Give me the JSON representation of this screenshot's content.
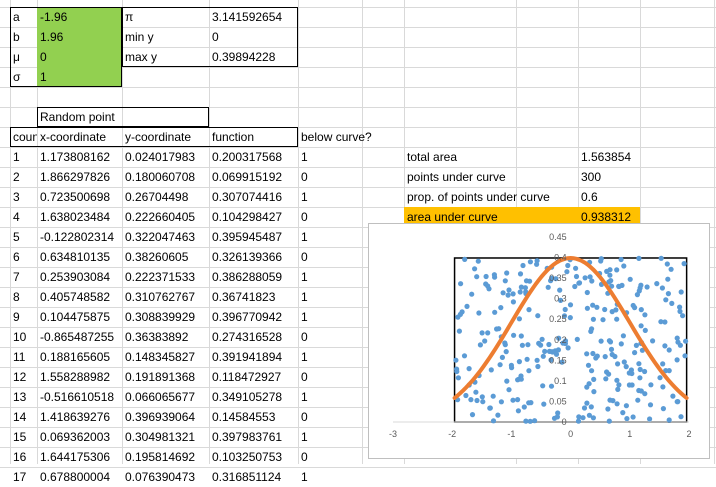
{
  "params": [
    {
      "label": "a",
      "value": "-1.96"
    },
    {
      "label": "b",
      "value": "1.96"
    },
    {
      "label": "μ",
      "value": "0"
    },
    {
      "label": "σ",
      "value": "1"
    }
  ],
  "constants": [
    {
      "label": "π",
      "value": "3.141592654"
    },
    {
      "label": "min y",
      "value": "0"
    },
    {
      "label": "max y",
      "value": "0.39894228"
    }
  ],
  "table": {
    "group_header": "Random point",
    "headers": [
      "count",
      "x-coordinate",
      "y-coordinate",
      "function",
      "below curve?"
    ],
    "rows": [
      [
        "1",
        "1.173808162",
        "0.024017983",
        "0.200317568",
        "1"
      ],
      [
        "2",
        "1.866297826",
        "0.180060708",
        "0.069915192",
        "0"
      ],
      [
        "3",
        "0.723500698",
        "0.26704498",
        "0.307074416",
        "1"
      ],
      [
        "4",
        "1.638023484",
        "0.222660405",
        "0.104298427",
        "0"
      ],
      [
        "5",
        "-0.122802314",
        "0.322047463",
        "0.395945487",
        "1"
      ],
      [
        "6",
        "0.634810135",
        "0.38260605",
        "0.326139366",
        "0"
      ],
      [
        "7",
        "0.253903084",
        "0.222371533",
        "0.386288059",
        "1"
      ],
      [
        "8",
        "0.405748582",
        "0.310762767",
        "0.36741823",
        "1"
      ],
      [
        "9",
        "0.104475875",
        "0.308839929",
        "0.396770942",
        "1"
      ],
      [
        "10",
        "-0.865487255",
        "0.36383892",
        "0.274316528",
        "0"
      ],
      [
        "11",
        "0.188165605",
        "0.148345827",
        "0.391941894",
        "1"
      ],
      [
        "12",
        "1.558288982",
        "0.191891368",
        "0.118472927",
        "0"
      ],
      [
        "13",
        "-0.516610518",
        "0.066065677",
        "0.349105278",
        "1"
      ],
      [
        "14",
        "1.418639276",
        "0.396939064",
        "0.14584553",
        "0"
      ],
      [
        "15",
        "0.069362003",
        "0.304981321",
        "0.397983761",
        "1"
      ],
      [
        "16",
        "1.644175306",
        "0.195814692",
        "0.103250753",
        "0"
      ],
      [
        "17",
        "0.678800004",
        "0.076390473",
        "0.316851124",
        "1"
      ]
    ]
  },
  "summary": [
    {
      "label": "total area",
      "value": "1.563854"
    },
    {
      "label": "points under curve",
      "value": "300"
    },
    {
      "label": "prop. of points under curve",
      "value": "0.6"
    },
    {
      "label": "area under curve",
      "value": "0.938312"
    }
  ],
  "colors": {
    "green": "#92d050",
    "orange": "#ffc000",
    "points": "#5b9bd5",
    "curve": "#ed7d31"
  },
  "chart_data": {
    "type": "scatter",
    "xlim": [
      -3,
      2
    ],
    "ylim": [
      0,
      0.45
    ],
    "x_ticks": [
      "-3",
      "-2",
      "-1",
      "0",
      "1",
      "2"
    ],
    "y_ticks": [
      "0",
      "0.05",
      "0.1",
      "0.15",
      "0.2",
      "0.25",
      "0.3",
      "0.35",
      "0.4",
      "0.45"
    ],
    "series": [
      {
        "kind": "scatter",
        "sample_count": 300,
        "x_range": [
          -1.96,
          1.96
        ],
        "y_range": [
          0,
          0.39894228
        ]
      },
      {
        "kind": "line",
        "function": "normal_pdf",
        "mu": 0,
        "sigma": 1,
        "x_range": [
          -1.96,
          1.96
        ]
      }
    ],
    "grid": false
  }
}
